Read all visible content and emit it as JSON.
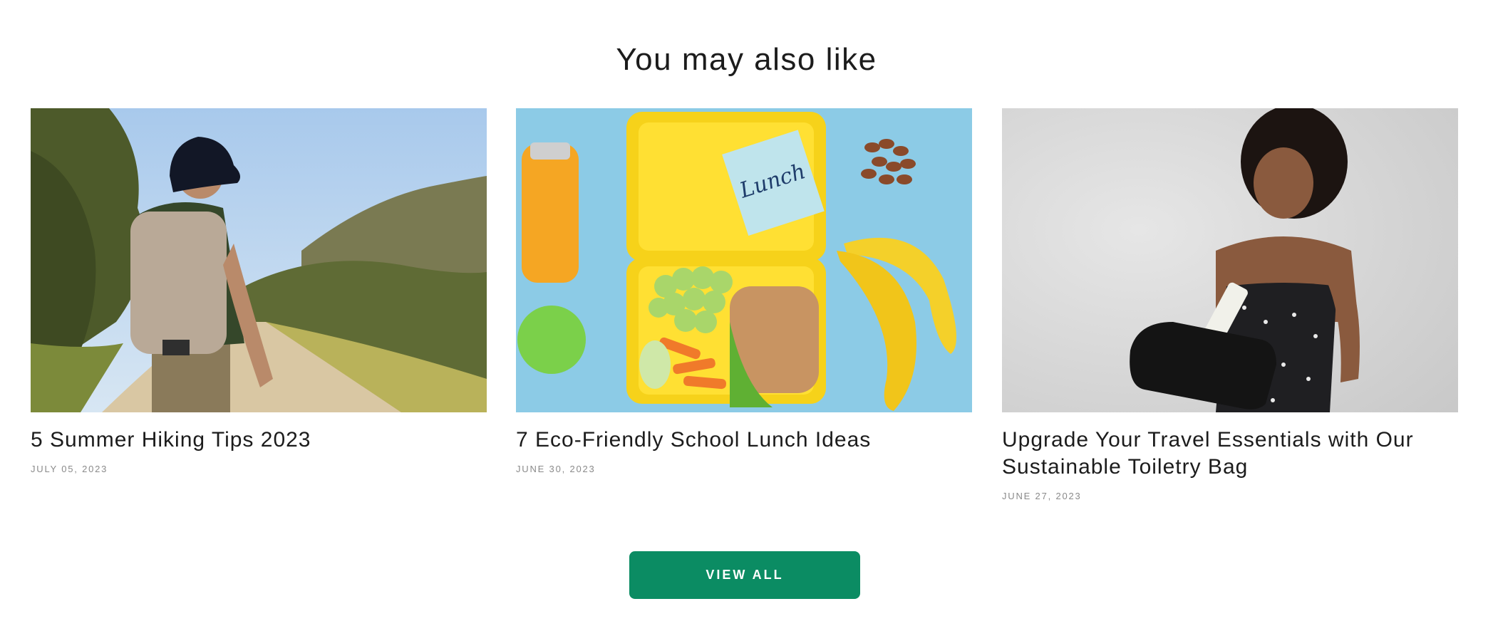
{
  "section": {
    "title": "You may also like"
  },
  "cards": [
    {
      "title": "5 Summer Hiking Tips 2023",
      "date": "JULY 05, 2023",
      "image": "hiker-on-trail-photo"
    },
    {
      "title": "7 Eco-Friendly School Lunch Ideas",
      "date": "JUNE 30, 2023",
      "image": "lunchbox-photo",
      "image_note_text": "Lunch"
    },
    {
      "title": "Upgrade Your Travel Essentials with Our Sustainable Toiletry Bag",
      "date": "JUNE 27, 2023",
      "image": "woman-with-toiletry-bag-photo"
    }
  ],
  "view_all": {
    "label": "VIEW ALL"
  },
  "colors": {
    "button": "#0b8c63",
    "title_text": "#1c1c1c",
    "date_text": "#8a8a8a"
  }
}
